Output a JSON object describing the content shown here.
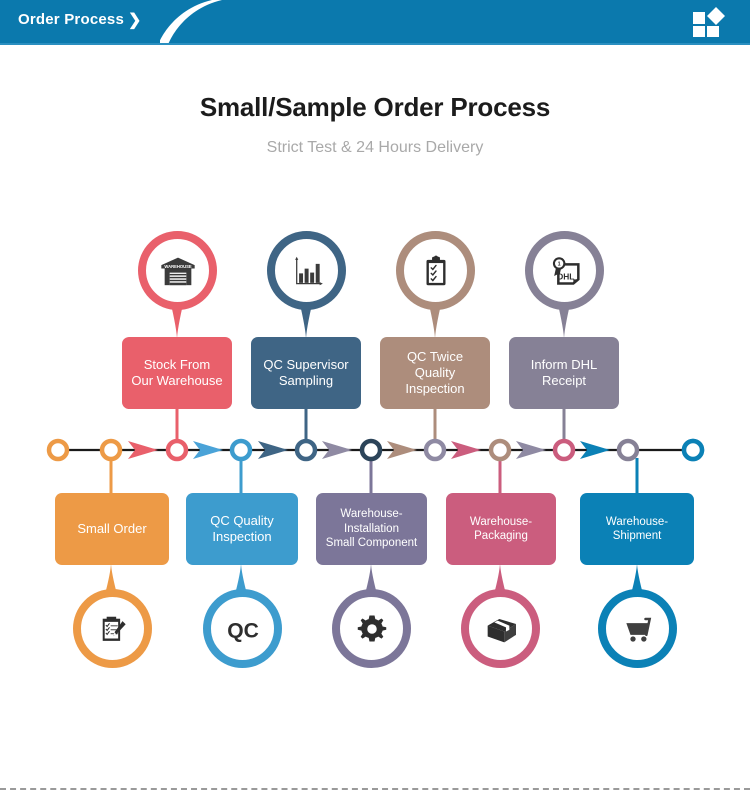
{
  "header": {
    "title": "Order Process",
    "chevron_icon": "chevron-right-icon",
    "logo_icon": "squares-diamond-logo-icon",
    "bg_color": "#0b79ad"
  },
  "titles": {
    "main": "Small/Sample Order Process",
    "sub": "Strict Test & 24 Hours Delivery"
  },
  "top_steps": [
    {
      "label": "Stock From\nOur Warehouse",
      "line1": "Stock From",
      "line2": "Our Warehouse",
      "color": "#e9606b",
      "icon": "warehouse-icon",
      "icon_text": "WAREHOUSE"
    },
    {
      "label": "QC Supervisor\nSampling",
      "line1": "QC Supervisor",
      "line2": "Sampling",
      "color": "#3f6585",
      "icon": "bar-chart-icon",
      "icon_text": ""
    },
    {
      "label": "QC Twice\nQuality Inspection",
      "line1": "QC Twice",
      "line2": "Quality Inspection",
      "color": "#ad8d7c",
      "icon": "clipboard-checklist-icon",
      "icon_text": ""
    },
    {
      "label": "Inform DHL\nReceipt",
      "line1": "Inform DHL",
      "line2": "Receipt",
      "color": "#868196",
      "icon": "dhl-award-document-icon",
      "icon_text": "DHL"
    }
  ],
  "bottom_steps": [
    {
      "line1": "Small Order",
      "line2": "",
      "line3": "",
      "color": "#ed9a46",
      "icon": "checklist-pencil-icon",
      "icon_text": ""
    },
    {
      "line1": "QC Quality",
      "line2": "Inspection",
      "line3": "",
      "color": "#3d9cce",
      "icon": "qc-text-icon",
      "icon_text": "QC"
    },
    {
      "line1": "Warehouse-",
      "line2": "Installation",
      "line3": "Small Component",
      "color": "#7c7699",
      "icon": "gear-icon",
      "icon_text": ""
    },
    {
      "line1": "Warehouse-",
      "line2": "Packaging",
      "line3": "",
      "color": "#cb5d7e",
      "icon": "package-box-icon",
      "icon_text": ""
    },
    {
      "line1": "Warehouse-",
      "line2": "Shipment",
      "line3": "",
      "color": "#0b81b6",
      "icon": "shopping-cart-icon",
      "icon_text": ""
    }
  ],
  "timeline": {
    "node_colors": [
      "#ed9a46",
      "#ed9a46",
      "#e9606b",
      "#3d9cce",
      "#3f6585",
      "#2c4459",
      "#8f8aa3",
      "#ad8d7c",
      "#cb5d7e",
      "#868196",
      "#0b81b6",
      "#0b81b6"
    ],
    "arrow_colors": [
      "#e9606b",
      "#4aa3d8",
      "#3f6585",
      "#8f8aa3",
      "#ad8d7c",
      "#cb5d7e",
      "#8f8aa3",
      "#0b81b6"
    ]
  },
  "footer": {
    "rule_style": "dashed",
    "rule_color": "#9a9a9a"
  }
}
